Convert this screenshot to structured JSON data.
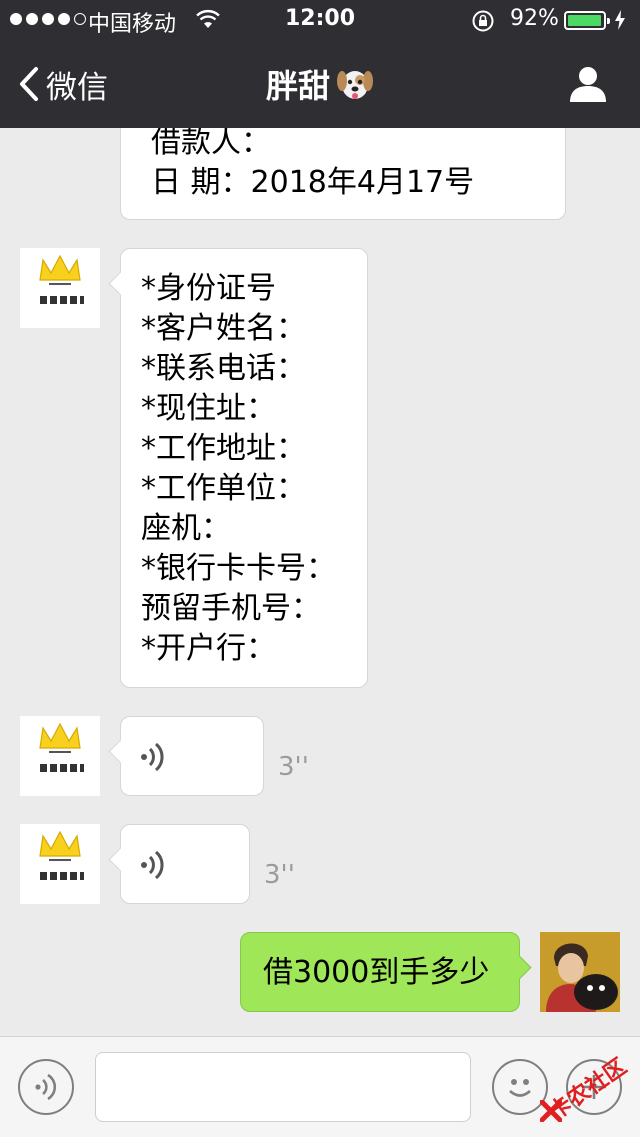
{
  "status_bar": {
    "carrier": "中国移动",
    "time": "12:00",
    "battery_percent": "92%",
    "battery_level": 0.92
  },
  "nav": {
    "back_label": "微信",
    "title": "胖甜"
  },
  "messages": [
    {
      "side": "left",
      "type": "text",
      "lines": [
        "借款人：",
        "日  期：2018年4月17号"
      ]
    },
    {
      "side": "left",
      "type": "text",
      "lines": [
        "*身份证号",
        "*客户姓名：",
        "*联系电话：",
        "*现住址：",
        "*工作地址：",
        "*工作单位：",
        "座机：",
        "*银行卡卡号：",
        "预留手机号：",
        "*开户行："
      ]
    },
    {
      "side": "left",
      "type": "voice",
      "duration": "3''"
    },
    {
      "side": "left",
      "type": "voice",
      "duration": "3''"
    },
    {
      "side": "right",
      "type": "text",
      "lines": [
        "借3000到手多少"
      ]
    }
  ],
  "watermark": {
    "text": "卡农社区"
  }
}
